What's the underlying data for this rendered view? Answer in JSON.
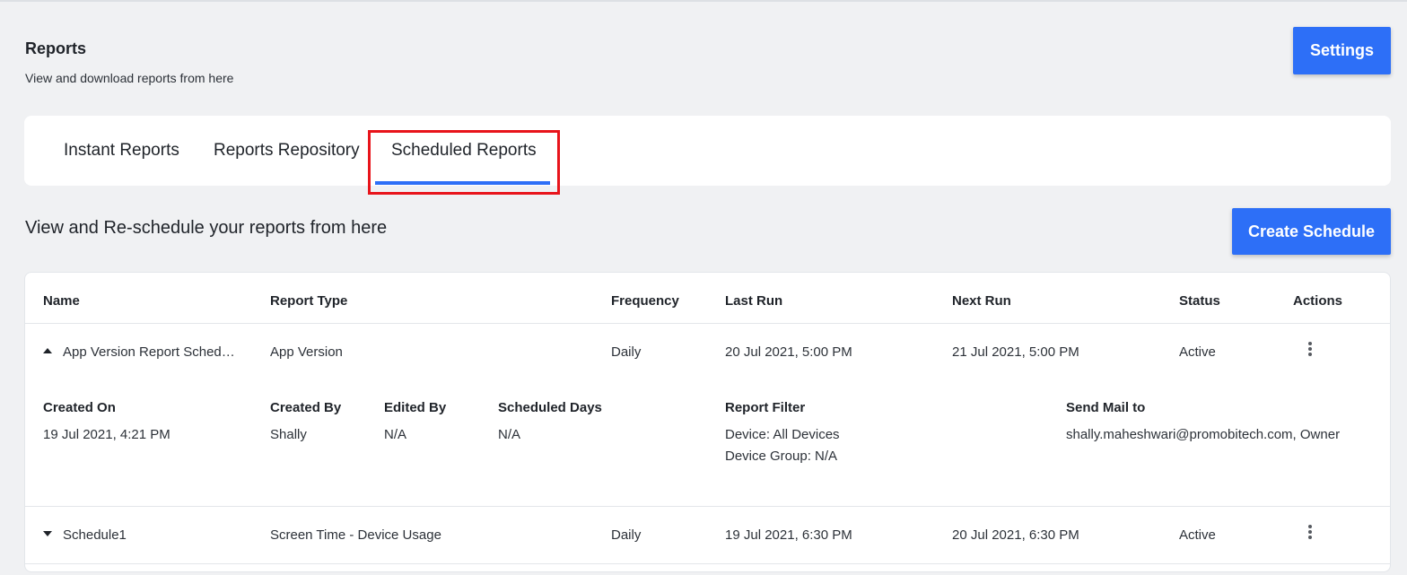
{
  "header": {
    "title": "Reports",
    "subtitle": "View and download reports from here",
    "settings_label": "Settings"
  },
  "tabs": [
    {
      "label": "Instant Reports",
      "active": false
    },
    {
      "label": "Reports Repository",
      "active": false
    },
    {
      "label": "Scheduled Reports",
      "active": true
    }
  ],
  "section": {
    "title": "View and Re-schedule your reports from here",
    "create_label": "Create Schedule"
  },
  "table": {
    "columns": [
      "Name",
      "Report Type",
      "Frequency",
      "Last Run",
      "Next Run",
      "Status",
      "Actions"
    ],
    "rows": [
      {
        "name": "App Version Report Sched…",
        "report_type": "App Version",
        "frequency": "Daily",
        "last_run": "20 Jul 2021, 5:00 PM",
        "next_run": "21 Jul 2021, 5:00 PM",
        "status": "Active",
        "expanded": true,
        "details": {
          "created_on_label": "Created On",
          "created_on": "19 Jul 2021, 4:21 PM",
          "created_by_label": "Created By",
          "created_by": "Shally",
          "edited_by_label": "Edited By",
          "edited_by": "N/A",
          "scheduled_days_label": "Scheduled Days",
          "scheduled_days": "N/A",
          "report_filter_label": "Report Filter",
          "filter_device": "Device: All Devices",
          "filter_group": "Device Group: N/A",
          "send_mail_label": "Send Mail to",
          "send_mail": "shally.maheshwari@promobitech.com, Owner"
        }
      },
      {
        "name": "Schedule1",
        "report_type": "Screen Time - Device Usage",
        "frequency": "Daily",
        "last_run": "19 Jul 2021, 6:30 PM",
        "next_run": "20 Jul 2021, 6:30 PM",
        "status": "Active",
        "expanded": false
      }
    ]
  },
  "colors": {
    "accent": "#2d6ff7",
    "highlight": "#e8141b",
    "background": "#f0f1f3"
  },
  "icons": {
    "expanded": "caret-up-icon",
    "collapsed": "caret-down-icon",
    "actions": "kebab-menu-icon"
  }
}
